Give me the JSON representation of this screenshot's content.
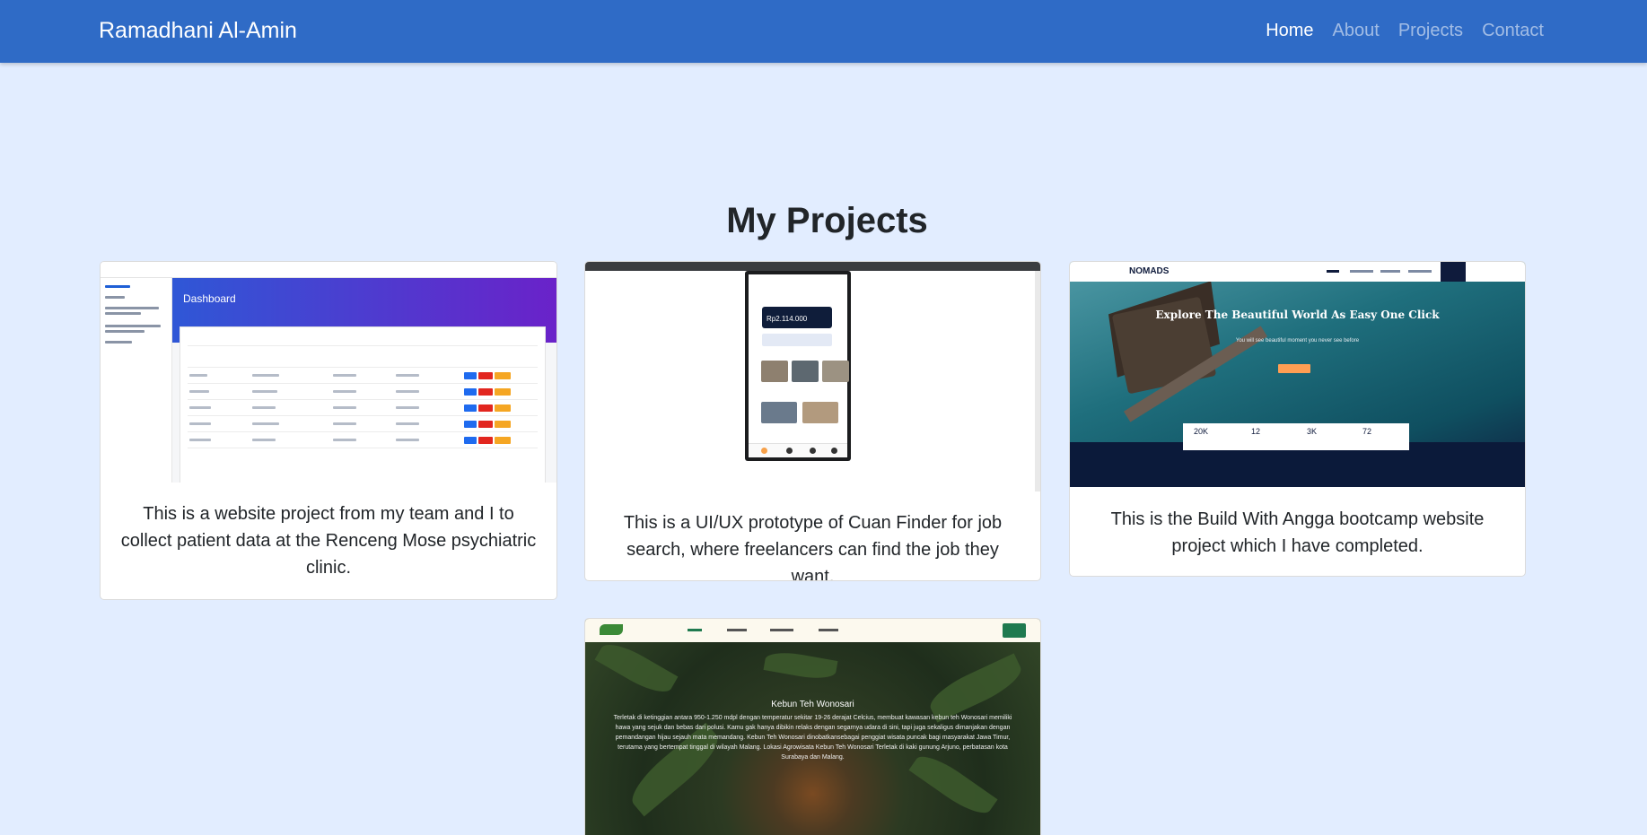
{
  "navbar": {
    "brand": "Ramadhani Al-Amin",
    "links": [
      {
        "label": "Home",
        "active": true
      },
      {
        "label": "About",
        "active": false
      },
      {
        "label": "Projects",
        "active": false
      },
      {
        "label": "Contact",
        "active": false
      }
    ]
  },
  "projects_section": {
    "title": "My Projects",
    "cards": [
      {
        "image_title": "Dashboard",
        "description": "This is a website project from my team and I to collect patient data at the Renceng Mose psychiatric clinic."
      },
      {
        "image_title": "Rp2.114.000",
        "description": "This is a UI/UX prototype of Cuan Finder for job search, where freelancers can find the job they want."
      },
      {
        "image_title": "Explore The Beautiful World As Easy One Click",
        "image_logo": "NOMADS",
        "image_subtitle": "You will see beautiful moment you never see before",
        "image_stats": [
          "20K",
          "12",
          "3K",
          "72"
        ],
        "description": "This is the Build With Angga bootcamp website project which I have completed."
      },
      {
        "image_title": "Kebun Teh Wonosari",
        "image_body": "Terletak di ketinggian antara 950-1.250 mdpl dengan temperatur sekitar 19-26 derajat Celcius, membuat kawasan kebun teh Wonosari memiliki hawa yang sejuk dan bebas dari polusi. Kamu gak hanya dibikin relaks dengan segarnya udara di sini, tapi juga sekaligus dimanjakan dengan pemandangan hijau sejauh mata memandang. Kebun Teh Wonosari dinobatkansebagai penggiat wisata puncak bagi masyarakat Jawa Timur, terutama yang bertempat tinggal di wilayah Malang. Lokasi Agrowisata Kebun Teh Wonosari Terletak di kaki gunung Arjuno, perbatasan kota Surabaya dan Malang.",
        "description": ""
      }
    ]
  },
  "colors": {
    "navbar": "#2f6bc6",
    "page_background": "#e2edff"
  }
}
